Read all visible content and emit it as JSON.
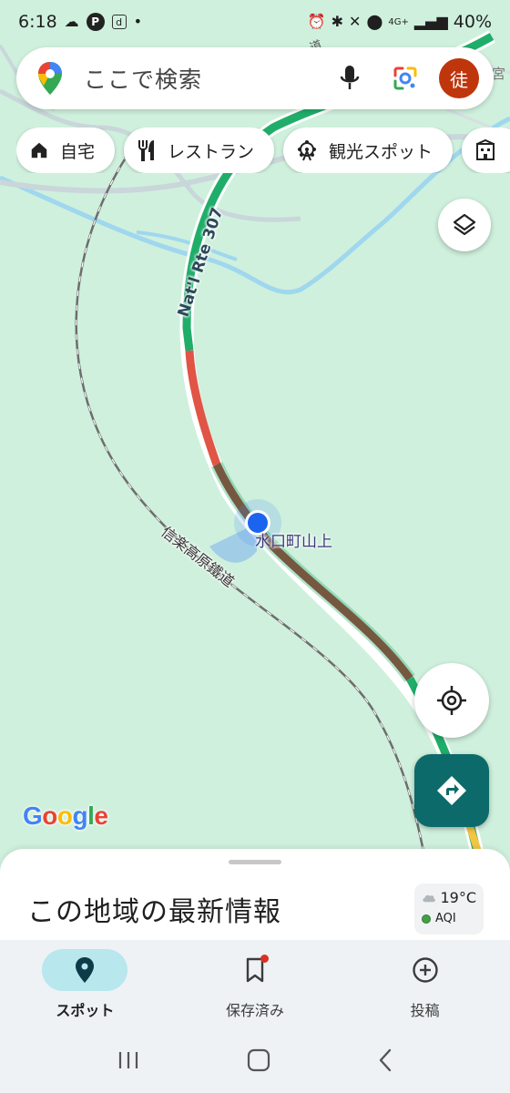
{
  "status_bar": {
    "time": "6:18",
    "battery": "40%",
    "network": "4G+"
  },
  "search": {
    "placeholder": "ここで検索",
    "avatar_letter": "徒"
  },
  "chips": [
    {
      "label": "自宅",
      "icon": "home-icon"
    },
    {
      "label": "レストラン",
      "icon": "restaurant-icon"
    },
    {
      "label": "観光スポット",
      "icon": "attractions-icon"
    }
  ],
  "map": {
    "road_label": "Nat'l Rte 307",
    "railway_label": "信楽高原鐵道",
    "place_label": "水口町山上",
    "edge_label": "宮",
    "top_edge_label": "道",
    "logo": "Google",
    "traffic_colors": {
      "free": "#1fae6a",
      "slow": "#e05545",
      "heavy": "#a52a2a"
    },
    "accent": "#0c6a6a"
  },
  "sheet": {
    "title": "この地域の最新情報",
    "weather_temp": "19°C",
    "aqi_label": "AQI"
  },
  "bottom_nav": [
    {
      "label": "スポット",
      "icon": "place-pin-icon",
      "active": true
    },
    {
      "label": "保存済み",
      "icon": "bookmark-icon",
      "active": false
    },
    {
      "label": "投稿",
      "icon": "add-circle-icon",
      "active": false
    }
  ]
}
